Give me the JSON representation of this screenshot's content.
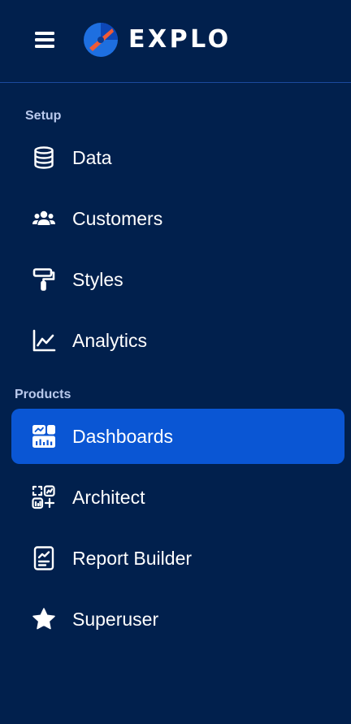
{
  "header": {
    "brand_name": "EXPLO",
    "icons": {
      "menu": "hamburger-menu-icon",
      "logo": "explo-logo-icon"
    }
  },
  "sections": {
    "setup": {
      "label": "Setup",
      "items": [
        {
          "label": "Data",
          "icon": "database-icon"
        },
        {
          "label": "Customers",
          "icon": "customers-icon"
        },
        {
          "label": "Styles",
          "icon": "paint-roller-icon"
        },
        {
          "label": "Analytics",
          "icon": "analytics-chart-icon"
        }
      ]
    },
    "products": {
      "label": "Products",
      "items": [
        {
          "label": "Dashboards",
          "icon": "dashboard-icon",
          "active": true
        },
        {
          "label": "Architect",
          "icon": "architect-icon"
        },
        {
          "label": "Report Builder",
          "icon": "report-icon"
        },
        {
          "label": "Superuser",
          "icon": "star-icon"
        }
      ]
    }
  },
  "colors": {
    "background": "#01204D",
    "active_item": "#0A56D4",
    "section_label": "#B9C9EC",
    "divider": "#1B4A9E",
    "logo_orange": "#F05A36",
    "logo_blue": "#1E6FE0"
  }
}
